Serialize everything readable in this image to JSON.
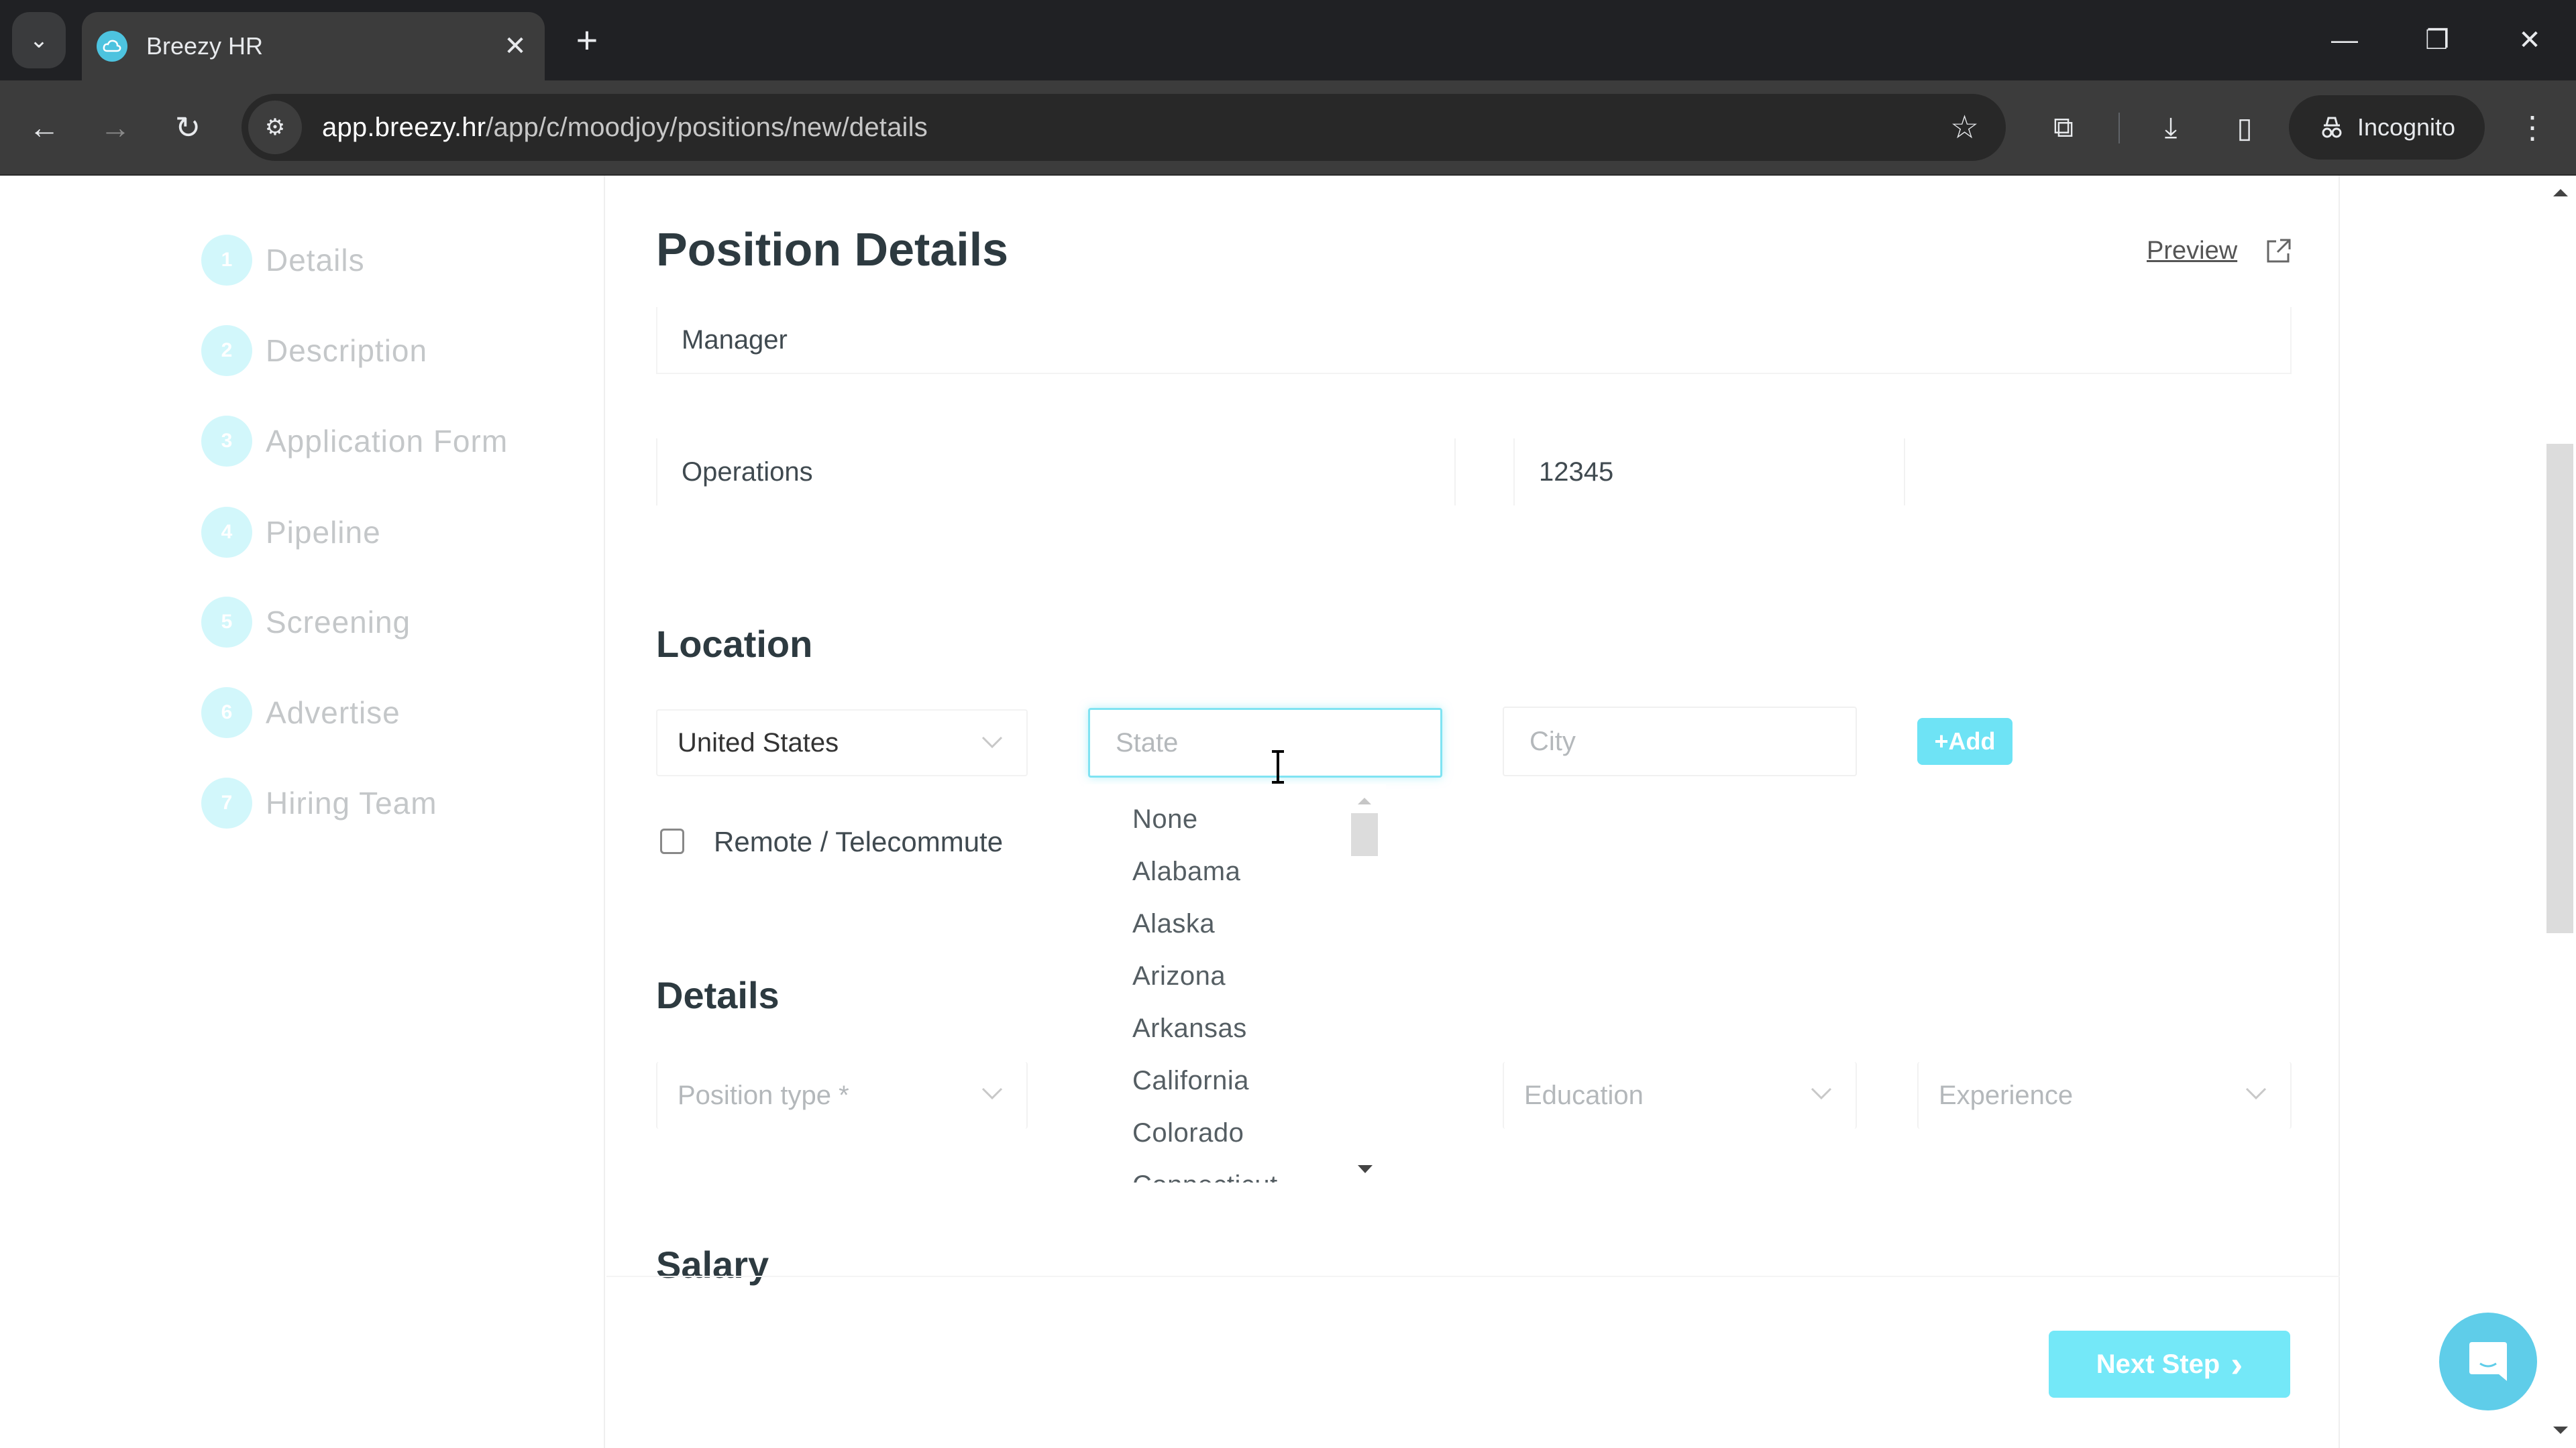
{
  "browser": {
    "tab_title": "Breezy HR",
    "url_host": "app.breezy.hr",
    "url_path": "/app/c/moodjoy/positions/new/details",
    "incognito_label": "Incognito",
    "icons": {
      "tab_menu": "chevron-down-icon",
      "favicon": "breezy-cloud-icon",
      "tab_close": "close-icon",
      "new_tab": "plus-icon",
      "minimize": "minimize-icon",
      "restore": "restore-icon",
      "close_window": "close-icon",
      "back": "arrow-left-icon",
      "forward": "arrow-right-icon",
      "reload": "reload-icon",
      "site_info": "tune-icon",
      "bookmark": "star-icon",
      "extensions": "puzzle-icon",
      "downloads": "download-icon",
      "side_panel": "side-panel-icon",
      "incognito": "incognito-icon",
      "menu": "kebab-icon"
    },
    "glyphs": {
      "tab_menu": "⌄",
      "tab_close": "✕",
      "new_tab": "+",
      "minimize": "—",
      "restore": "❐",
      "close_window": "✕",
      "back": "←",
      "forward": "→",
      "reload": "↻",
      "site_info": "⚙",
      "bookmark": "☆",
      "extensions": "⧉",
      "downloads": "⤓",
      "side_panel": "▯",
      "menu": "⋮"
    }
  },
  "sidebar": {
    "steps": [
      {
        "number": "1",
        "label": "Details"
      },
      {
        "number": "2",
        "label": "Description"
      },
      {
        "number": "3",
        "label": "Application Form"
      },
      {
        "number": "4",
        "label": "Pipeline"
      },
      {
        "number": "5",
        "label": "Screening"
      },
      {
        "number": "6",
        "label": "Advertise"
      },
      {
        "number": "7",
        "label": "Hiring Team"
      }
    ]
  },
  "main": {
    "title": "Position Details",
    "preview_label": "Preview",
    "position_title_value": "Manager",
    "department_value": "Operations",
    "requisition_value": "12345",
    "location": {
      "heading": "Location",
      "country_value": "United States",
      "state_placeholder": "State",
      "city_placeholder": "City",
      "add_label": "+Add",
      "remote_label": "Remote / Telecommute",
      "remote_checked": false,
      "state_options": [
        "None",
        "Alabama",
        "Alaska",
        "Arizona",
        "Arkansas",
        "California",
        "Colorado",
        "Connecticut"
      ]
    },
    "details": {
      "heading": "Details",
      "position_type_placeholder": "Position type *",
      "education_placeholder": "Education",
      "experience_placeholder": "Experience"
    },
    "salary": {
      "heading": "Salary"
    },
    "next_step_label": "Next Step",
    "next_step_glyph": "›"
  },
  "colors": {
    "accent": "#74e8f8",
    "accent_soft": "#d2f7fb",
    "chat": "#5fcde9",
    "focus_border": "#7fe3f2"
  }
}
